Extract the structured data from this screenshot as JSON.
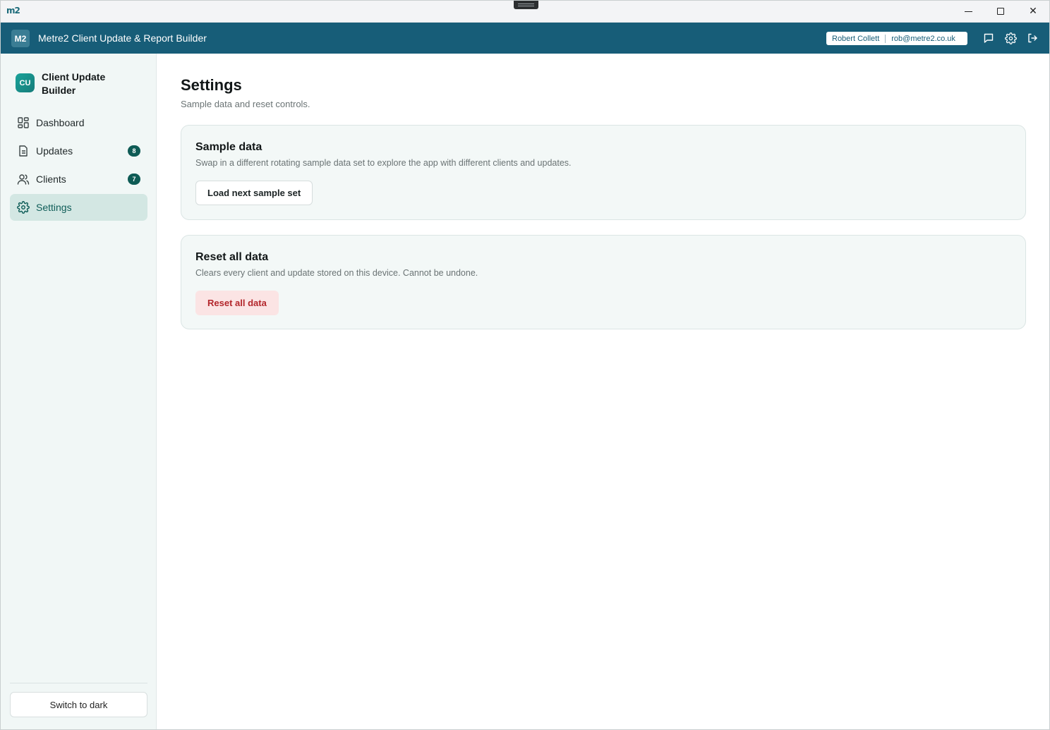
{
  "os": {
    "logo": "m2",
    "controls": {
      "minimize": "minimize",
      "maximize": "maximize",
      "close": "✕"
    }
  },
  "header": {
    "badge": "M2",
    "title": "Metre2 Client Update & Report Builder",
    "user_name": "Robert Collett",
    "user_email": "rob@metre2.co.uk",
    "icons": [
      "message-icon",
      "gear-icon",
      "logout-icon"
    ]
  },
  "sidebar": {
    "brand_badge": "CU",
    "brand_name": "Client Update Builder",
    "items": [
      {
        "label": "Dashboard",
        "icon": "dashboard-icon"
      },
      {
        "label": "Updates",
        "icon": "document-icon",
        "count": "8"
      },
      {
        "label": "Clients",
        "icon": "users-icon",
        "count": "7"
      },
      {
        "label": "Settings",
        "icon": "gear-icon",
        "active": true
      }
    ],
    "theme_button": "Switch to dark"
  },
  "main": {
    "title": "Settings",
    "subtitle": "Sample data and reset controls.",
    "sample_card": {
      "title": "Sample data",
      "description": "Swap in a different rotating sample data set to explore the app with different clients and updates.",
      "button": "Load next sample set"
    },
    "reset_card": {
      "title": "Reset all data",
      "description": "Clears every client and update stored on this device. Cannot be undone.",
      "button": "Reset all data"
    }
  },
  "colors": {
    "header_bg": "#175d78",
    "accent": "#0e5b55",
    "danger": "#b3262b",
    "danger_bg": "#fbe4e4"
  }
}
